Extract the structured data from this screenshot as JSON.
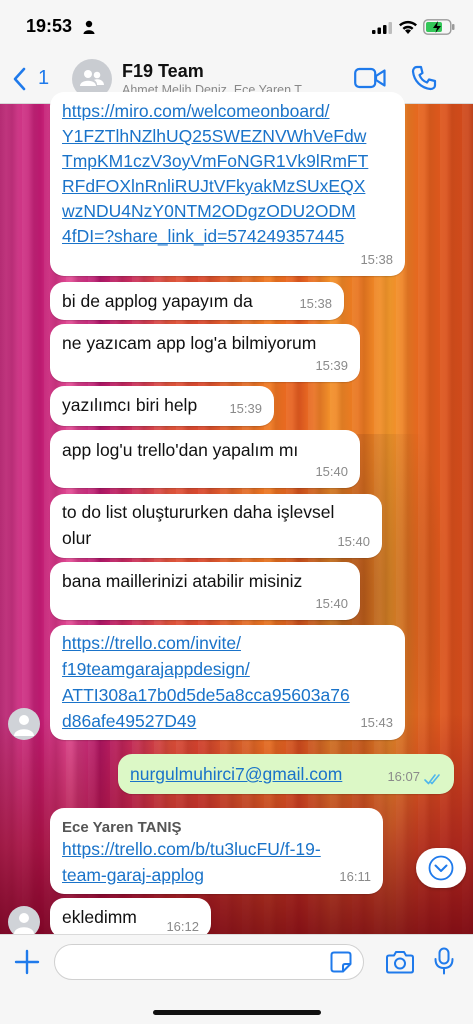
{
  "status_bar": {
    "time": "19:53",
    "icons": [
      "person-icon",
      "cellular-signal-icon",
      "wifi-icon",
      "battery-charging-icon"
    ]
  },
  "header": {
    "back_count": "1",
    "title": "F19 Team",
    "subtitle": "Ahmet Melih Deniz, Ece Yaren T...",
    "icons": [
      "back-chevron-icon",
      "group-avatar-icon",
      "video-call-icon",
      "phone-call-icon"
    ]
  },
  "messages": [
    {
      "direction": "in",
      "lines": [
        "https://miro.com/welcomeonboard/",
        "Y1FZTlhNZlhUQ25SWEZNVWhVeFdw",
        "TmpKM1czV3oyVmFoNGR1Vk9lRmFT",
        "RFdFOXlnRnliRUJtVFkyakMzSUxEQX",
        "wzNDU4NzY0NTM2ODgzODU2ODM",
        "4fDI=?share_link_id=574249357445"
      ],
      "time": "15:38"
    },
    {
      "direction": "in",
      "text": "bi de applog yapayım da",
      "time": "15:38"
    },
    {
      "direction": "in",
      "text": "ne yazıcam app log'a bilmiyorum",
      "time": "15:39"
    },
    {
      "direction": "in",
      "text": "yazılımcı biri help",
      "time": "15:39"
    },
    {
      "direction": "in",
      "text": "app log'u trello'dan yapalım mı",
      "time": "15:40"
    },
    {
      "direction": "in",
      "lines": [
        "to do list oluştururken daha işlevsel",
        "olur"
      ],
      "time": "15:40"
    },
    {
      "direction": "in",
      "text": "bana maillerinizi atabilir misiniz",
      "time": "15:40"
    },
    {
      "direction": "in",
      "lines": [
        "https://trello.com/invite/",
        "f19teamgarajappdesign/",
        "ATTI308a17b0d5de5a8cca95603a76",
        "d86afe49527D49"
      ],
      "time": "15:43"
    },
    {
      "direction": "out",
      "text": "nurgulmuhirci7@gmail.com",
      "time": "16:07",
      "status": "read"
    },
    {
      "direction": "in",
      "sender": "Ece Yaren TANIŞ",
      "lines": [
        "https://trello.com/b/tu3lucFU/f-19-",
        "team-garaj-applog"
      ],
      "time": "16:11"
    },
    {
      "direction": "in",
      "text": "ekledimm",
      "time": "16:12"
    }
  ],
  "input_bar": {
    "placeholder": "",
    "icons": [
      "plus-icon",
      "sticker-icon",
      "camera-icon",
      "microphone-icon"
    ]
  },
  "colors": {
    "accent": "#1f7aeb",
    "link": "#1a73c9",
    "outgoing_bubble": "#dcf8c6",
    "incoming_bubble": "#ffffff",
    "read_ticks": "#4fb6ec"
  }
}
